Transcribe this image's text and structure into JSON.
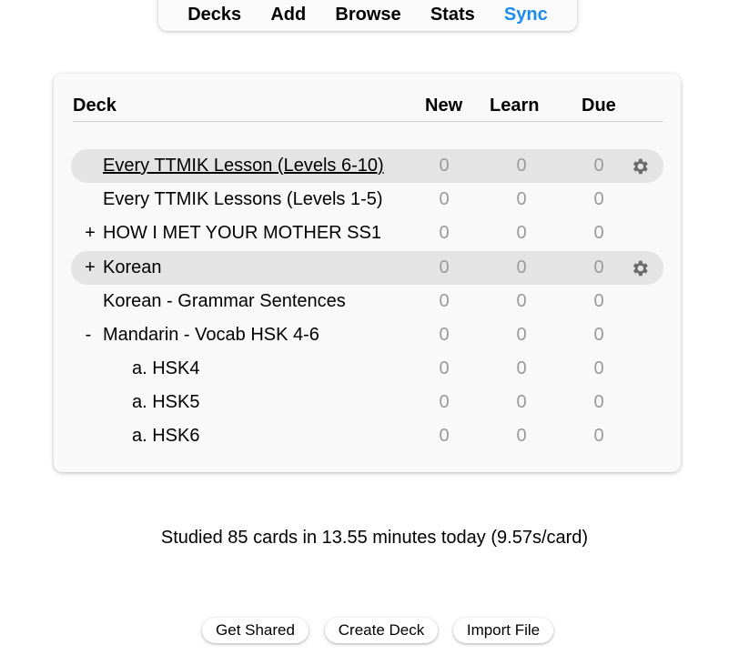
{
  "nav": {
    "items": [
      {
        "label": "Decks"
      },
      {
        "label": "Add"
      },
      {
        "label": "Browse"
      },
      {
        "label": "Stats"
      },
      {
        "label": "Sync"
      }
    ]
  },
  "colors": {
    "accent": "#1a8cf0",
    "count_gray": "#9a9a9a",
    "current_row_bg": "#e4e4e4"
  },
  "table": {
    "headers": {
      "deck": "Deck",
      "new": "New",
      "learn": "Learn",
      "due": "Due"
    },
    "rows": [
      {
        "collapse": "",
        "name": "Every TTMIK Lesson (Levels 6-10)",
        "new": "0",
        "learn": "0",
        "due": "0",
        "current": true,
        "gear": "gear-icon"
      },
      {
        "collapse": "",
        "name": "Every TTMIK Lessons (Levels 1-5)",
        "new": "0",
        "learn": "0",
        "due": "0"
      },
      {
        "collapse": "+",
        "name": "HOW I MET YOUR MOTHER SS1",
        "new": "0",
        "learn": "0",
        "due": "0"
      },
      {
        "collapse": "+",
        "name": "Korean",
        "new": "0",
        "learn": "0",
        "due": "0",
        "current": true,
        "gear": "gear-icon"
      },
      {
        "collapse": "",
        "name": "Korean - Grammar Sentences",
        "new": "0",
        "learn": "0",
        "due": "0"
      },
      {
        "collapse": "-",
        "name": "Mandarin - Vocab HSK 4-6",
        "new": "0",
        "learn": "0",
        "due": "0"
      },
      {
        "collapse": "",
        "name": "a. HSK4",
        "new": "0",
        "learn": "0",
        "due": "0"
      },
      {
        "collapse": "",
        "name": "a. HSK5",
        "new": "0",
        "learn": "0",
        "due": "0"
      },
      {
        "collapse": "",
        "name": "a. HSK6",
        "new": "0",
        "learn": "0",
        "due": "0"
      }
    ]
  },
  "studied_text": "Studied 85 cards in 13.55 minutes today (9.57s/card)",
  "buttons": {
    "get_shared": "Get Shared",
    "create_deck": "Create Deck",
    "import_file": "Import File"
  }
}
